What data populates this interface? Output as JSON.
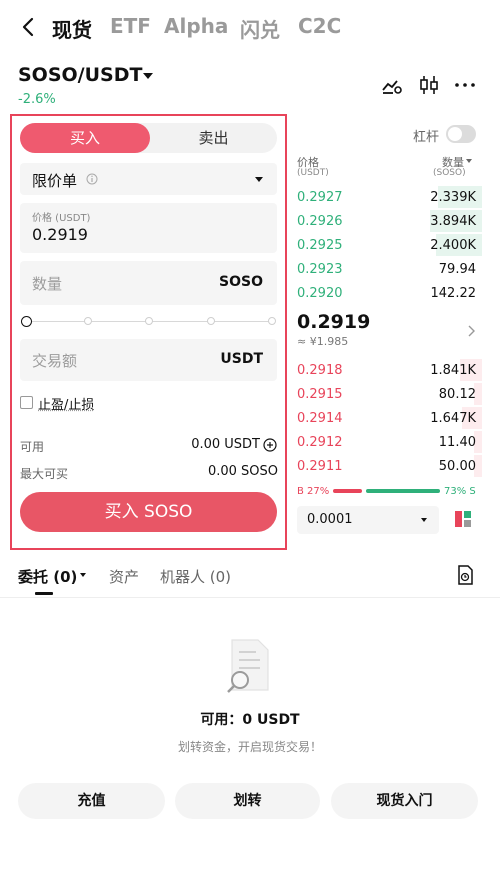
{
  "nav": {
    "tabs": [
      "现货",
      "ETF",
      "Alpha",
      "闪兑",
      "C2C"
    ]
  },
  "pair": {
    "name": "SOSO/USDT",
    "change": "-2.6%"
  },
  "form": {
    "buy_tab": "买入",
    "sell_tab": "卖出",
    "order_type": "限价单",
    "price_label": "价格 (USDT)",
    "price_value": "0.2919",
    "qty_placeholder": "数量",
    "qty_unit": "SOSO",
    "amount_placeholder": "交易额",
    "amount_unit": "USDT",
    "tpsl_label": "止盈/止损",
    "available_label": "可用",
    "available_value": "0.00 USDT",
    "max_buy_label": "最大可买",
    "max_buy_value": "0.00 SOSO",
    "submit_label": "买入 SOSO"
  },
  "orderbook": {
    "leverage_label": "杠杆",
    "col_price": "价格",
    "col_price_unit": "(USDT)",
    "col_qty": "数量",
    "col_qty_unit": "(SOSO)",
    "bids_top": [
      {
        "price": "0.2927",
        "qty": "2.339K"
      },
      {
        "price": "0.2926",
        "qty": "3.894K"
      },
      {
        "price": "0.2925",
        "qty": "2.400K"
      },
      {
        "price": "0.2923",
        "qty": "79.94"
      },
      {
        "price": "0.2920",
        "qty": "142.22"
      }
    ],
    "last_price": "0.2919",
    "last_price_cny": "≈ ¥1.985",
    "asks_bottom": [
      {
        "price": "0.2918",
        "qty": "1.841K"
      },
      {
        "price": "0.2915",
        "qty": "80.12"
      },
      {
        "price": "0.2914",
        "qty": "1.647K"
      },
      {
        "price": "0.2912",
        "qty": "11.40"
      },
      {
        "price": "0.2911",
        "qty": "50.00"
      }
    ],
    "ratio_b": "B 27%",
    "ratio_s": "73% S",
    "ratio_b_value": 27,
    "precision": "0.0001"
  },
  "bottom": {
    "tab_orders": "委托 (0)",
    "tab_assets": "资产",
    "tab_bots": "机器人 (0)",
    "empty_available": "可用：0 USDT",
    "empty_hint": "划转资金，开启现货交易！",
    "btn_deposit": "充值",
    "btn_transfer": "划转",
    "btn_guide": "现货入门"
  },
  "colors": {
    "buy": "#e8445a",
    "sell_green": "#2fb07a"
  }
}
